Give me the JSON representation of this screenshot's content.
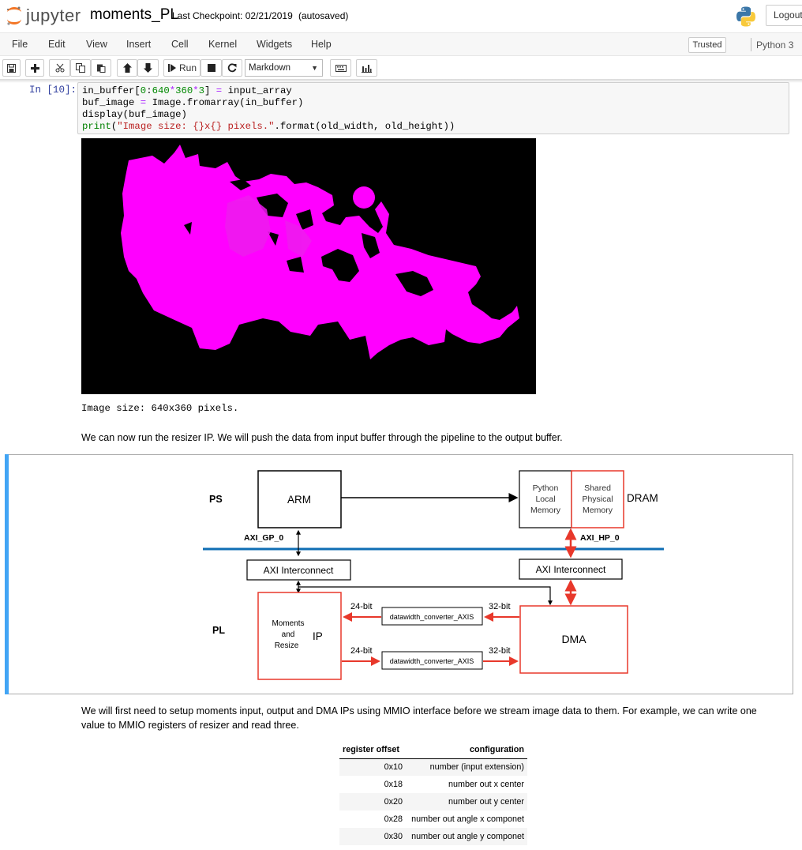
{
  "header": {
    "logo_text": "jupyter",
    "notebook_name": "moments_PL",
    "checkpoint": "Last Checkpoint: 02/21/2019",
    "autosave_status": "(autosaved)",
    "logout_label": "Logout"
  },
  "menu": {
    "items": [
      "File",
      "Edit",
      "View",
      "Insert",
      "Cell",
      "Kernel",
      "Widgets",
      "Help"
    ],
    "trusted_label": "Trusted",
    "kernel_name": "Python 3"
  },
  "toolbar": {
    "run_label": "Run",
    "cell_type": "Markdown",
    "icons": [
      "save-icon",
      "plus-icon",
      "scissors-icon",
      "copy-icon",
      "paste-icon",
      "arrow-up-icon",
      "arrow-down-icon",
      "step-forward-icon",
      "stop-icon",
      "restart-icon",
      "keyboard-icon",
      "bar-chart-icon"
    ]
  },
  "code_cell": {
    "prompt": "In [10]:",
    "lines": [
      "in_buffer[0:640*360*3] = input_array",
      "buf_image = Image.fromarray(in_buffer)",
      "display(buf_image)",
      "print(\"Image size: {}x{} pixels.\".format(old_width, old_height))"
    ],
    "output_text": "Image size: 640x360 pixels."
  },
  "markdown": {
    "run_text": "We can now run the resizer IP. We will push the data from input buffer through the pipeline to the output buffer.",
    "setup_text": "We will first need to setup moments input, output and DMA IPs using MMIO interface before we stream image data to them. For example, we can write one value to MMIO registers of resizer and read three."
  },
  "diagram": {
    "ps_label": "PS",
    "pl_label": "PL",
    "arm_label": "ARM",
    "python_memory_lines": [
      "Python",
      "Local",
      "Memory"
    ],
    "shared_memory_lines": [
      "Shared",
      "Physical",
      "Memory"
    ],
    "dram_label": "DRAM",
    "axi_gp_label": "AXI_GP_0",
    "axi_hp_label": "AXI_HP_0",
    "interconnect_label": "AXI Interconnect",
    "moments_lines": [
      "Moments",
      "and",
      "Resize"
    ],
    "ip_label": "IP",
    "converter_label": "datawidth_converter_AXIS",
    "bit24_label": "24-bit",
    "bit32_label": "32-bit",
    "dma_label": "DMA",
    "bus_color": "#0f6eb4",
    "accent_red": "#e8382b"
  },
  "register_table": {
    "headers": [
      "register offset",
      "configuration"
    ],
    "rows": [
      [
        "0x10",
        "number (input extension)"
      ],
      [
        "0x18",
        "number out x center"
      ],
      [
        "0x20",
        "number out y center"
      ],
      [
        "0x28",
        "number out angle x componet"
      ],
      [
        "0x30",
        "number out angle y componet"
      ]
    ]
  },
  "colors": {
    "prompt_blue": "#303f9f",
    "selected_cell_bar": "#42a5f5",
    "magenta_shape": "#ff00ff"
  }
}
